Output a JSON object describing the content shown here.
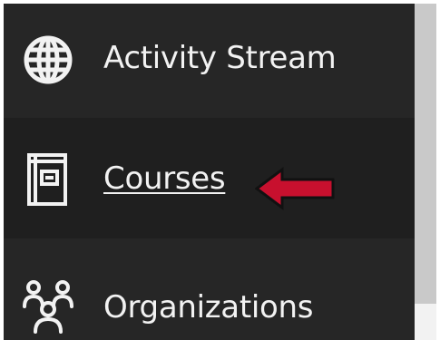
{
  "sidebar": {
    "items": [
      {
        "label": "Activity Stream",
        "icon": "globe-icon",
        "underlined": false
      },
      {
        "label": "Courses",
        "icon": "book-icon",
        "underlined": true
      },
      {
        "label": "Organizations",
        "icon": "people-icon",
        "underlined": false
      }
    ]
  },
  "annotation": {
    "icon": "red-arrow-icon",
    "color": "#c8102e"
  },
  "colors": {
    "sidebar_bg": "#262626",
    "active_row_bg": "#1f1f1f",
    "text": "#f2f2f2",
    "content_bg": "#c9c9c9"
  }
}
